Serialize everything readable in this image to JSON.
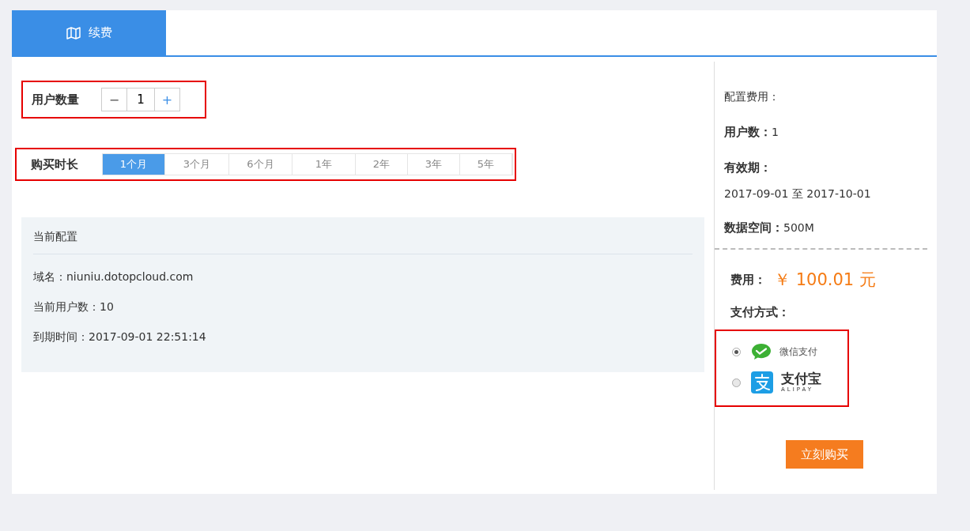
{
  "tabs": [
    {
      "label": "续费",
      "selected": true
    }
  ],
  "user_count": {
    "label": "用户数量",
    "minus": "−",
    "value": "1",
    "plus": "+"
  },
  "duration": {
    "label": "购买时长",
    "options": [
      {
        "label": "1个月",
        "selected": true
      },
      {
        "label": "3个月",
        "selected": false
      },
      {
        "label": "6个月",
        "selected": false
      },
      {
        "label": "1年",
        "selected": false
      },
      {
        "label": "2年",
        "selected": false
      },
      {
        "label": "3年",
        "selected": false
      },
      {
        "label": "5年",
        "selected": false
      }
    ]
  },
  "current_config": {
    "title": "当前配置",
    "lines": [
      "域名：niuniu.dotopcloud.com",
      "当前用户数：10",
      "到期时间：2017-09-01 22:51:14"
    ]
  },
  "summary": {
    "heading": "配置费用：",
    "users_label": "用户数：",
    "users_value": "1",
    "validity_label": "有效期：",
    "validity_value": "2017-09-01 至 2017-10-01",
    "space_label": "数据空间：",
    "space_value": "500M"
  },
  "fee": {
    "label": "费用：",
    "amount": "￥ 100.01 元"
  },
  "payment": {
    "label": "支付方式：",
    "options": [
      {
        "kind": "wechat",
        "name": "微信支付",
        "selected": true
      },
      {
        "kind": "alipay",
        "name": "支付宝",
        "subtitle": "ALIPAY",
        "selected": false
      }
    ]
  },
  "buy_button": "立刻购买"
}
